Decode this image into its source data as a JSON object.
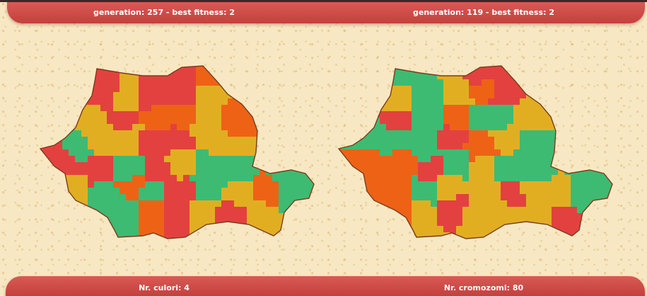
{
  "header": {
    "left_text": "generation: 257 - best fitness: 2",
    "right_text": "generation: 119 - best fitness: 2"
  },
  "footer": {
    "left_text": "Nr. culori: 4",
    "right_text": "Nr. cromozomi: 80"
  },
  "colors": {
    "green": "#3dbb72",
    "orange": "#ee6216",
    "red": "#e3413f",
    "yellow": "#e2ae21",
    "border": "#7a3b1d",
    "bar": "#cf4b46"
  },
  "maps": [
    {
      "name": "map-left",
      "palette": [
        "green",
        "orange",
        "red",
        "yellow"
      ],
      "seed": 3
    },
    {
      "name": "map-right",
      "palette": [
        "red",
        "green",
        "yellow",
        "orange"
      ],
      "seed": 11
    }
  ]
}
